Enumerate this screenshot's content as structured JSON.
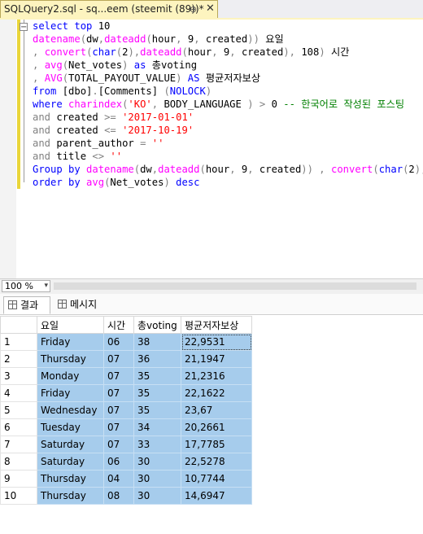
{
  "tab": {
    "title": "SQLQuery2.sql - sq...eem (steemit (89))*",
    "pin": "⊕",
    "close": "✕"
  },
  "code_lines": [
    [
      {
        "c": "kw",
        "t": "select top "
      },
      {
        "c": "tx",
        "t": "10"
      }
    ],
    [
      {
        "c": "fn",
        "t": "datename"
      },
      {
        "c": "op",
        "t": "("
      },
      {
        "c": "tx",
        "t": "dw"
      },
      {
        "c": "op",
        "t": ","
      },
      {
        "c": "fn",
        "t": "dateadd"
      },
      {
        "c": "op",
        "t": "("
      },
      {
        "c": "tx",
        "t": "hour"
      },
      {
        "c": "op",
        "t": ", "
      },
      {
        "c": "tx",
        "t": "9"
      },
      {
        "c": "op",
        "t": ", "
      },
      {
        "c": "tx",
        "t": "created"
      },
      {
        "c": "op",
        "t": "))"
      },
      {
        "c": "tx",
        "t": " 요일"
      }
    ],
    [
      {
        "c": "op",
        "t": ", "
      },
      {
        "c": "fn",
        "t": "convert"
      },
      {
        "c": "op",
        "t": "("
      },
      {
        "c": "kw",
        "t": "char"
      },
      {
        "c": "op",
        "t": "("
      },
      {
        "c": "tx",
        "t": "2"
      },
      {
        "c": "op",
        "t": "),"
      },
      {
        "c": "fn",
        "t": "dateadd"
      },
      {
        "c": "op",
        "t": "("
      },
      {
        "c": "tx",
        "t": "hour"
      },
      {
        "c": "op",
        "t": ", "
      },
      {
        "c": "tx",
        "t": "9"
      },
      {
        "c": "op",
        "t": ", "
      },
      {
        "c": "tx",
        "t": "created"
      },
      {
        "c": "op",
        "t": "), "
      },
      {
        "c": "tx",
        "t": "108"
      },
      {
        "c": "op",
        "t": ")"
      },
      {
        "c": "tx",
        "t": " 시간"
      }
    ],
    [
      {
        "c": "op",
        "t": ", "
      },
      {
        "c": "fn",
        "t": "avg"
      },
      {
        "c": "op",
        "t": "("
      },
      {
        "c": "tx",
        "t": "Net_votes"
      },
      {
        "c": "op",
        "t": ")"
      },
      {
        "c": "kw",
        "t": " as "
      },
      {
        "c": "tx",
        "t": "총voting"
      }
    ],
    [
      {
        "c": "op",
        "t": ", "
      },
      {
        "c": "fn",
        "t": "AVG"
      },
      {
        "c": "op",
        "t": "("
      },
      {
        "c": "tx",
        "t": "TOTAL_PAYOUT_VALUE"
      },
      {
        "c": "op",
        "t": ")"
      },
      {
        "c": "kw",
        "t": " AS "
      },
      {
        "c": "tx",
        "t": "평균저자보상"
      }
    ],
    [
      {
        "c": "kw",
        "t": "from "
      },
      {
        "c": "tx",
        "t": "[dbo]"
      },
      {
        "c": "op",
        "t": "."
      },
      {
        "c": "tx",
        "t": "[Comments] "
      },
      {
        "c": "op",
        "t": "("
      },
      {
        "c": "kw",
        "t": "NOLOCK"
      },
      {
        "c": "op",
        "t": ")"
      }
    ],
    [
      {
        "c": "kw",
        "t": "where "
      },
      {
        "c": "fn",
        "t": "charindex"
      },
      {
        "c": "op",
        "t": "("
      },
      {
        "c": "str",
        "t": "'KO'"
      },
      {
        "c": "op",
        "t": ", "
      },
      {
        "c": "tx",
        "t": "BODY_LANGUAGE "
      },
      {
        "c": "op",
        "t": ") > "
      },
      {
        "c": "tx",
        "t": "0 "
      },
      {
        "c": "cm",
        "t": "-- 한국어로 작성된 포스팅"
      }
    ],
    [
      {
        "c": "op",
        "t": "and "
      },
      {
        "c": "tx",
        "t": "created "
      },
      {
        "c": "op",
        "t": ">= "
      },
      {
        "c": "str",
        "t": "'2017-01-01'"
      }
    ],
    [
      {
        "c": "op",
        "t": "and "
      },
      {
        "c": "tx",
        "t": "created "
      },
      {
        "c": "op",
        "t": "<= "
      },
      {
        "c": "str",
        "t": "'2017-10-19'"
      }
    ],
    [
      {
        "c": "op",
        "t": "and "
      },
      {
        "c": "tx",
        "t": "parent_author "
      },
      {
        "c": "op",
        "t": "= "
      },
      {
        "c": "str",
        "t": "''"
      }
    ],
    [
      {
        "c": "op",
        "t": "and "
      },
      {
        "c": "tx",
        "t": "title "
      },
      {
        "c": "op",
        "t": "<> "
      },
      {
        "c": "str",
        "t": "''"
      }
    ],
    [
      {
        "c": "kw",
        "t": "Group by "
      },
      {
        "c": "fn",
        "t": "datename"
      },
      {
        "c": "op",
        "t": "("
      },
      {
        "c": "tx",
        "t": "dw"
      },
      {
        "c": "op",
        "t": ","
      },
      {
        "c": "fn",
        "t": "dateadd"
      },
      {
        "c": "op",
        "t": "("
      },
      {
        "c": "tx",
        "t": "hour"
      },
      {
        "c": "op",
        "t": ", "
      },
      {
        "c": "tx",
        "t": "9"
      },
      {
        "c": "op",
        "t": ", "
      },
      {
        "c": "tx",
        "t": "created"
      },
      {
        "c": "op",
        "t": ")) , "
      },
      {
        "c": "fn",
        "t": "convert"
      },
      {
        "c": "op",
        "t": "("
      },
      {
        "c": "kw",
        "t": "char"
      },
      {
        "c": "op",
        "t": "("
      },
      {
        "c": "tx",
        "t": "2"
      },
      {
        "c": "op",
        "t": "),"
      },
      {
        "c": "tx",
        "t": "dat"
      }
    ],
    [
      {
        "c": "kw",
        "t": "order by "
      },
      {
        "c": "fn",
        "t": "avg"
      },
      {
        "c": "op",
        "t": "("
      },
      {
        "c": "tx",
        "t": "Net_votes"
      },
      {
        "c": "op",
        "t": ")"
      },
      {
        "c": "kw",
        "t": " desc"
      }
    ]
  ],
  "statusbar": {
    "zoom": "100 %",
    "zoom_arrow": "▾"
  },
  "result_tabs": [
    {
      "label": "결과"
    },
    {
      "label": "메시지"
    }
  ],
  "results": {
    "columns": [
      "요일",
      "시간",
      "총voting",
      "평균저자보상"
    ],
    "rows": [
      [
        "1",
        "Friday",
        "06",
        "38",
        "22,9531"
      ],
      [
        "2",
        "Thursday",
        "07",
        "36",
        "21,1947"
      ],
      [
        "3",
        "Monday",
        "07",
        "35",
        "21,2316"
      ],
      [
        "4",
        "Friday",
        "07",
        "35",
        "22,1622"
      ],
      [
        "5",
        "Wednesday",
        "07",
        "35",
        "23,67"
      ],
      [
        "6",
        "Tuesday",
        "07",
        "34",
        "20,2661"
      ],
      [
        "7",
        "Saturday",
        "07",
        "33",
        "17,7785"
      ],
      [
        "8",
        "Saturday",
        "06",
        "30",
        "22,5278"
      ],
      [
        "9",
        "Thursday",
        "04",
        "30",
        "10,7744"
      ],
      [
        "10",
        "Thursday",
        "08",
        "30",
        "14,6947"
      ]
    ]
  }
}
